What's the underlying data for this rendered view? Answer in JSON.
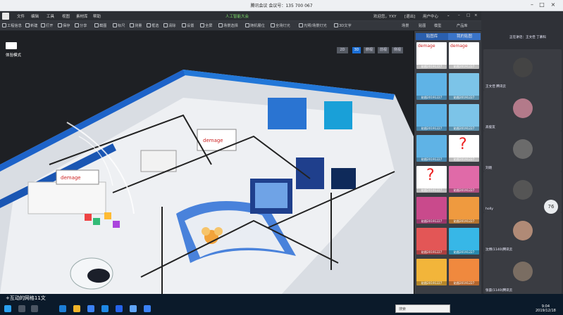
{
  "meeting": {
    "title": "腾讯会议 会议号：135 700 067"
  },
  "menu": {
    "items": [
      "文件",
      "编辑",
      "工具",
      "视图",
      "素材库",
      "帮助"
    ],
    "center": "人工智能大会",
    "user": "欢迎您，YXY",
    "logout": "[退出]",
    "usercenter": "用户中心"
  },
  "toolbar": {
    "items": [
      "工程信息",
      "新建",
      "打开",
      "保存",
      "分享",
      "截图",
      "标尺",
      "测量",
      "框选",
      "清除",
      "设置",
      "全屏",
      "场景选择",
      "随机展位",
      "全场灯光",
      "光照/场景灯光",
      "3D文字"
    ],
    "right": [
      "场景",
      "贴图",
      "模型",
      "产品库"
    ]
  },
  "viewport": {
    "mode_label": "体验模式",
    "view_3d": "3D",
    "view_buttons": [
      "2D",
      "俯视",
      "前视",
      "侧视"
    ]
  },
  "right_panel": {
    "tabs": [
      "贴图库",
      "我的贴图"
    ],
    "cards": [
      {
        "title": "demage",
        "cap": "贴图20191227",
        "color": "#ffffff"
      },
      {
        "title": "demage",
        "cap": "贴图20191227",
        "color": "#ffffff"
      },
      {
        "title": "",
        "cap": "贴图20191227",
        "color": "#5fb3e6"
      },
      {
        "title": "",
        "cap": "贴图20191227",
        "color": "#7cc4e8"
      },
      {
        "title": "",
        "cap": "贴图20191227",
        "color": "#5fb3e6"
      },
      {
        "title": "",
        "cap": "贴图20191227",
        "color": "#7cc4e8"
      },
      {
        "title": "",
        "cap": "贴图20191227",
        "color": "#5fb3e6"
      },
      {
        "title": "?",
        "cap": "贴图20191227",
        "color": "#ffffff"
      },
      {
        "title": "?",
        "cap": "贴图20191227",
        "color": "#ffffff"
      },
      {
        "title": "",
        "cap": "贴图20191227",
        "color": "#e06aa8"
      },
      {
        "title": "",
        "cap": "贴图20191227",
        "color": "#c94a8c"
      },
      {
        "title": "",
        "cap": "贴图20191227",
        "color": "#ef9a3f"
      },
      {
        "title": "",
        "cap": "贴图20191227",
        "color": "#e35656"
      },
      {
        "title": "",
        "cap": "贴图20191227",
        "color": "#37b7e7"
      },
      {
        "title": "",
        "cap": "贴图20191227",
        "color": "#f2b53a"
      },
      {
        "title": "",
        "cap": "贴图20191227",
        "color": "#f0893e"
      }
    ]
  },
  "video": {
    "header": "正在讲话：王文佳 丁慕科",
    "tiles": [
      {
        "name": "王文佳 腾讯云",
        "color": "#444"
      },
      {
        "name": "高俊友",
        "color": "#b37a8a"
      },
      {
        "name": "刘晓",
        "color": "#6b6b6b"
      },
      {
        "name": "holly",
        "color": "#555"
      },
      {
        "name": "沈博(1140)腾讯云",
        "color": "#b08a76"
      },
      {
        "name": "张晨(1140)腾讯云",
        "color": "#7a6d62"
      }
    ],
    "badge": "76"
  },
  "taskbar": {
    "subtitle": "+互动的网格11文",
    "search_placeholder": "搜索",
    "time": "9:04",
    "date": "2019/12/18"
  }
}
